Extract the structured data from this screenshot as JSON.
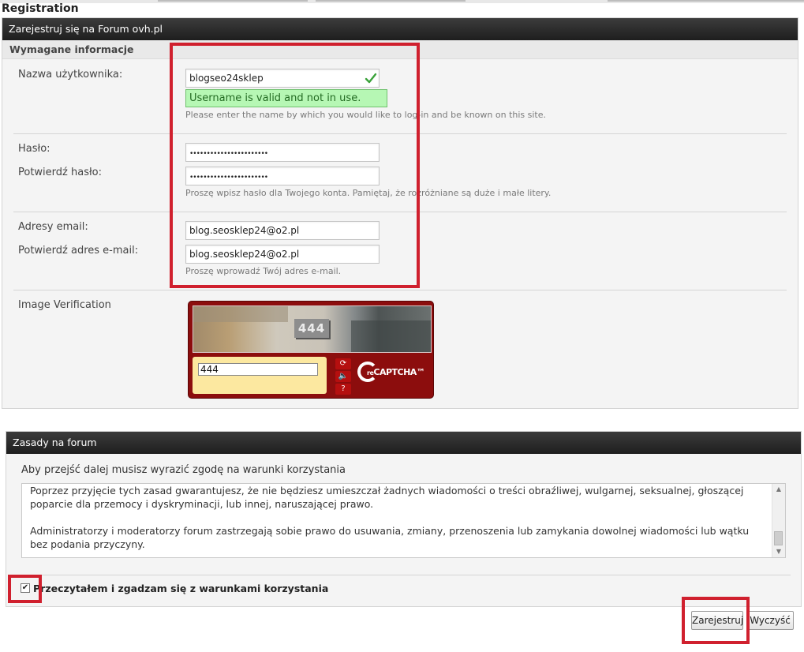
{
  "page": {
    "title": "Registration"
  },
  "registration": {
    "header": "Zarejestruj się na Forum ovh.pl",
    "section_title": "Wymagane informacje",
    "username": {
      "label": "Nazwa użytkownika:",
      "value": "blogseo24sklep",
      "valid_message": "Username is valid and not in use.",
      "hint": "Please enter the name by which you would like to log-in and be known on this site."
    },
    "password": {
      "label": "Hasło:",
      "confirm_label": "Potwierdź hasło:",
      "value": "•••••••••••••••••••••••",
      "confirm_value": "•••••••••••••••••••••••",
      "hint": "Proszę wpisz hasło dla Twojego konta. Pamiętaj, że rozróżniane są duże i małe litery."
    },
    "email": {
      "label": "Adresy email:",
      "confirm_label": "Potwierdź adres e-mail:",
      "value": "blog.seosklep24@o2.pl",
      "confirm_value": "blog.seosklep24@o2.pl",
      "hint": "Proszę wprowadź Twój adres e-mail."
    },
    "captcha": {
      "label": "Image Verification",
      "image_text": "444",
      "input_value": "444",
      "logo_re": "re",
      "logo_text": "CAPTCHA™"
    }
  },
  "rules": {
    "header": "Zasady na forum",
    "intro": "Aby przejść dalej musisz wyrazić zgodę na warunki korzystania",
    "paragraphs": [
      "Poprzez przyjęcie tych zasad gwarantujesz, że nie będziesz umieszczał żadnych wiadomości o treści obraźliwej, wulgarnej, seksualnej, głoszącej poparcie dla przemocy i dyskryminacji, lub innej, naruszającej prawo.",
      "Administratorzy i moderatorzy forum zastrzegają sobie prawo do usuwania, zmiany, przenoszenia lub zamykania dowolnej wiadomości lub wątku bez podania przyczyny."
    ],
    "agree_label": "Przeczytałem i zgadzam się z warunkami korzystania",
    "agree_checked": true
  },
  "buttons": {
    "submit": "Zarejestruj",
    "reset": "Wyczyść"
  },
  "colors": {
    "header_bg": "#262626",
    "valid_bg": "#b6f7b4",
    "highlight": "#d0202e",
    "captcha_red": "#8c0d0d"
  },
  "icons": {
    "valid": "checkmark-icon",
    "reload": "refresh-icon",
    "audio": "audio-icon",
    "help": "help-icon",
    "checkbox": "checkbox-checked-icon"
  }
}
